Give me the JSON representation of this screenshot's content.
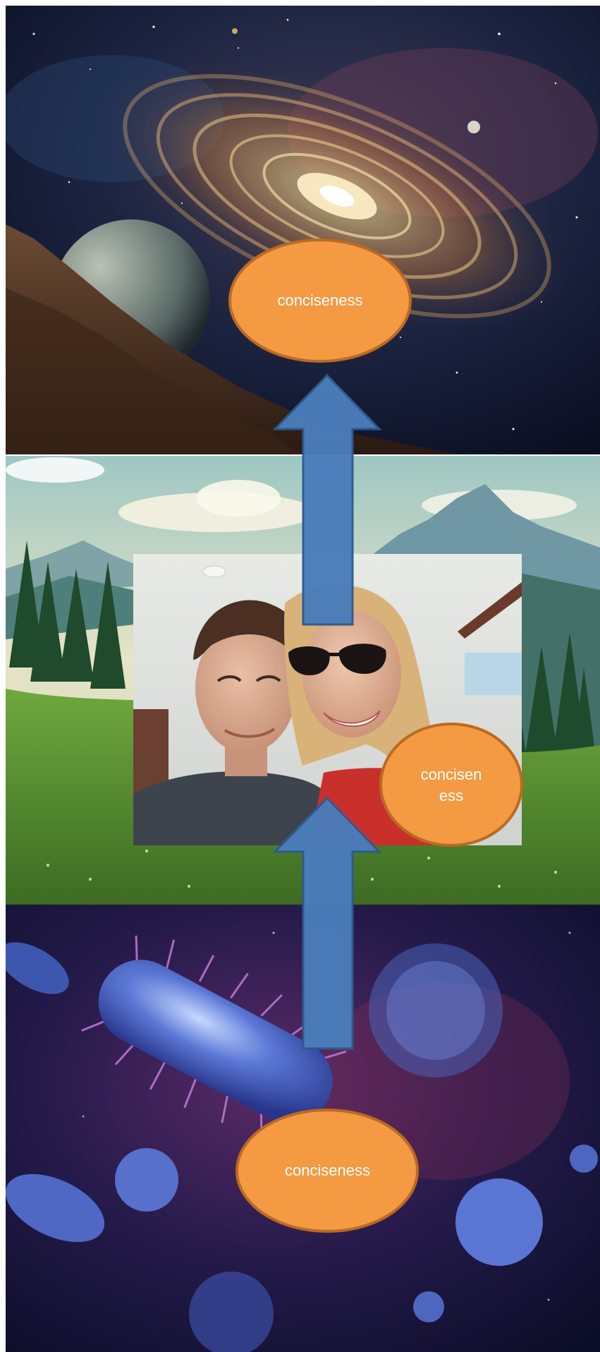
{
  "diagram": {
    "nodes": [
      {
        "id": "top",
        "label": "conciseness"
      },
      {
        "id": "middle",
        "label": "concisen\ness"
      },
      {
        "id": "bottom",
        "label": "conciseness"
      }
    ],
    "arrows": [
      {
        "from": "bottom",
        "to": "middle",
        "direction": "up"
      },
      {
        "from": "middle",
        "to": "top",
        "direction": "up"
      }
    ],
    "backgrounds": [
      {
        "name": "galaxy-image",
        "description_icon": "spiral-galaxy"
      },
      {
        "name": "mountain-meadow-image",
        "description_icon": "mountains"
      },
      {
        "name": "bacteria-image",
        "description_icon": "microbes"
      }
    ],
    "inset_photo": {
      "name": "selfie-photo",
      "icon": "couple-selfie"
    }
  },
  "colors": {
    "ellipse_fill": "#f39a43",
    "ellipse_stroke": "#bb6a22",
    "arrow_fill": "#4a7dbb",
    "arrow_stroke": "#2e5a8e",
    "label_text": "#ffffff"
  }
}
